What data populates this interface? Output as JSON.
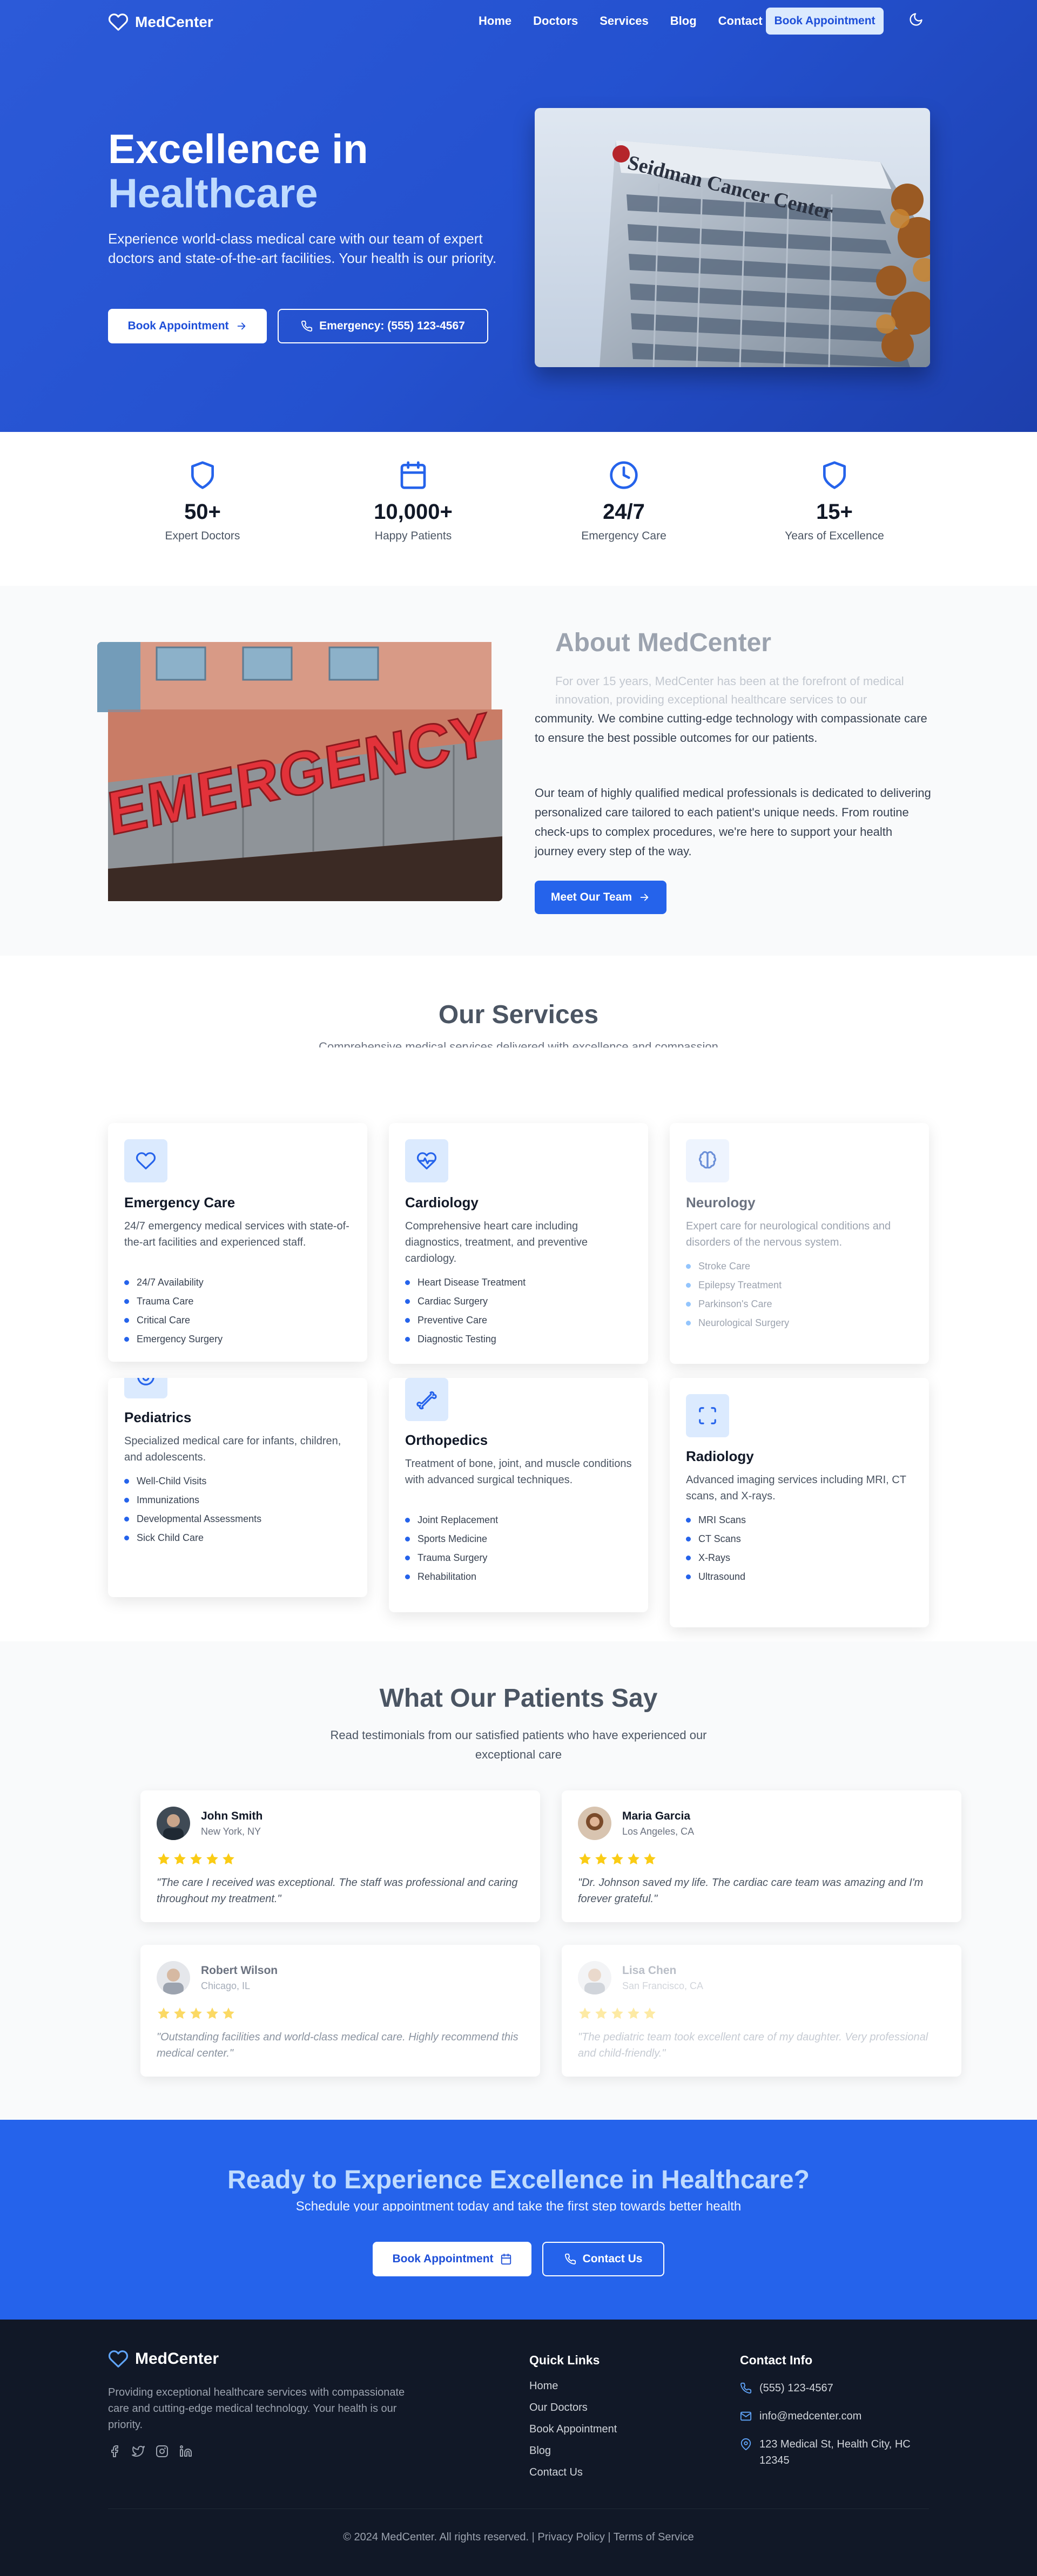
{
  "nav": {
    "brand": "MedCenter",
    "links": [
      "Home",
      "Doctors",
      "Services",
      "Blog",
      "Contact"
    ],
    "cta": "Book Appointment"
  },
  "hero": {
    "title_line1": "Excellence in",
    "title_line2": "Healthcare",
    "subtitle": "Experience world-class medical care with our team of expert doctors and state-of-the-art facilities. Your health is our priority.",
    "primary_button": "Book Appointment",
    "secondary_button": "Emergency: (555) 123-4567",
    "image_sign": "Seidman Cancer Center"
  },
  "stats": [
    {
      "icon": "shield-icon",
      "value": "50+",
      "label": "Expert Doctors"
    },
    {
      "icon": "calendar-icon",
      "value": "10,000+",
      "label": "Happy Patients"
    },
    {
      "icon": "clock-icon",
      "value": "24/7",
      "label": "Emergency Care"
    },
    {
      "icon": "shield-icon",
      "value": "15+",
      "label": "Years of Excellence"
    }
  ],
  "about": {
    "title": "About MedCenter",
    "p1a": "For over 15 years, MedCenter has been at the forefront of medical innovation, providing exceptional healthcare services to our",
    "p1b": "community. We combine cutting-edge technology with compassionate care to ensure the best possible outcomes for our patients.",
    "p2": "Our team of highly qualified medical professionals is dedicated to delivering personalized care tailored to each patient's unique needs. From routine check-ups to complex procedures, we're here to support your health journey every step of the way.",
    "button": "Meet Our Team",
    "image_sign": "EMERGENCY"
  },
  "services": {
    "title": "Our Services",
    "subtitle": "Comprehensive medical services delivered with excellence and compassion",
    "cards": [
      {
        "icon": "heart-icon",
        "title": "Emergency Care",
        "desc": "24/7 emergency medical services with state-of-the-art facilities and experienced staff.",
        "items": [
          "24/7 Availability",
          "Trauma Care",
          "Critical Care",
          "Emergency Surgery"
        ]
      },
      {
        "icon": "heart-pulse-icon",
        "title": "Cardiology",
        "desc": "Comprehensive heart care including diagnostics, treatment, and preventive cardiology.",
        "items": [
          "Heart Disease Treatment",
          "Cardiac Surgery",
          "Preventive Care",
          "Diagnostic Testing"
        ]
      },
      {
        "icon": "brain-icon",
        "title": "Neurology",
        "desc": "Expert care for neurological conditions and disorders of the nervous system.",
        "items": [
          "Stroke Care",
          "Epilepsy Treatment",
          "Parkinson's Care",
          "Neurological Surgery"
        ]
      },
      {
        "icon": "baby-icon",
        "title": "Pediatrics",
        "desc": "Specialized medical care for infants, children, and adolescents.",
        "items": [
          "Well-Child Visits",
          "Immunizations",
          "Developmental Assessments",
          "Sick Child Care"
        ]
      },
      {
        "icon": "bone-icon",
        "title": "Orthopedics",
        "desc": "Treatment of bone, joint, and muscle conditions with advanced surgical techniques.",
        "items": [
          "Joint Replacement",
          "Sports Medicine",
          "Trauma Surgery",
          "Rehabilitation"
        ]
      },
      {
        "icon": "scan-icon",
        "title": "Radiology",
        "desc": "Advanced imaging services including MRI, CT scans, and X-rays.",
        "items": [
          "MRI Scans",
          "CT Scans",
          "X-Rays",
          "Ultrasound"
        ]
      }
    ]
  },
  "testimonials": {
    "title": "What Our Patients Say",
    "subtitle": "Read testimonials from our satisfied patients who have experienced our exceptional care",
    "items": [
      {
        "name": "John Smith",
        "location": "New York, NY",
        "rating": 5,
        "quote": "\"The care I received was exceptional. The staff was professional and caring throughout my treatment.\""
      },
      {
        "name": "Maria Garcia",
        "location": "Los Angeles, CA",
        "rating": 5,
        "quote": "\"Dr. Johnson saved my life. The cardiac care team was amazing and I'm forever grateful.\""
      },
      {
        "name": "Robert Wilson",
        "location": "Chicago, IL",
        "rating": 5,
        "quote": "\"Outstanding facilities and world-class medical care. Highly recommend this medical center.\""
      },
      {
        "name": "Lisa Chen",
        "location": "San Francisco, CA",
        "rating": 5,
        "quote": "\"The pediatric team took excellent care of my daughter. Very professional and child-friendly.\""
      }
    ]
  },
  "cta": {
    "title": "Ready to Experience Excellence in Healthcare?",
    "subtitle": "Schedule your appointment today and take the first step towards better health",
    "primary_button": "Book Appointment",
    "secondary_button": "Contact Us"
  },
  "footer": {
    "brand": "MedCenter",
    "description": "Providing exceptional healthcare services with compassionate care and cutting-edge medical technology. Your health is our priority.",
    "quick_links_title": "Quick Links",
    "quick_links": [
      "Home",
      "Our Doctors",
      "Book Appointment",
      "Blog",
      "Contact Us"
    ],
    "contact_title": "Contact Info",
    "phone": "(555) 123-4567",
    "email": "info@medcenter.com",
    "address": "123 Medical St, Health City, HC 12345",
    "copyright": "© 2024 MedCenter. All rights reserved. | Privacy Policy | Terms of Service"
  },
  "colors": {
    "primary": "#2563eb",
    "hero_gradient_start": "#2c5ad8",
    "hero_gradient_end": "#1d3fad",
    "footer_bg": "#111827",
    "star": "#facc15"
  }
}
